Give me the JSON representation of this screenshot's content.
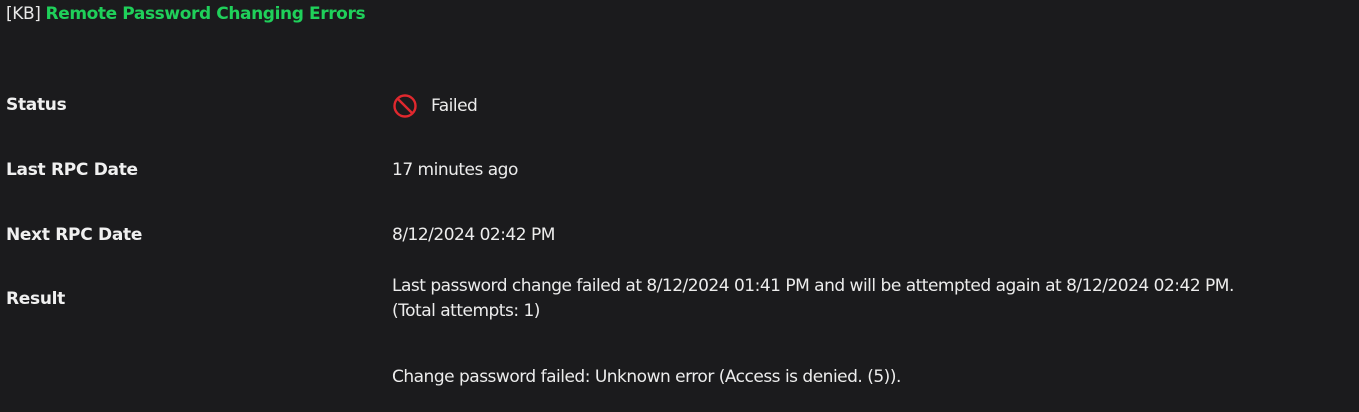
{
  "header": {
    "prefix": "[KB]",
    "link_text": "Remote Password Changing Errors"
  },
  "rows": {
    "status": {
      "label": "Status",
      "value": "Failed",
      "icon": "prohibited-icon",
      "icon_color": "#e0282e"
    },
    "last_rpc": {
      "label": "Last RPC Date",
      "value": "17 minutes ago"
    },
    "next_rpc": {
      "label": "Next RPC Date",
      "value": "8/12/2024 02:42 PM"
    },
    "result": {
      "label": "Result",
      "line1": "Last password change failed at 8/12/2024 01:41 PM and will be attempted again at 8/12/2024 02:42 PM.",
      "line2": "(Total attempts: 1)",
      "error": "Change password failed: Unknown error (Access is denied. (5))."
    }
  },
  "colors": {
    "background": "#1b1b1d",
    "link": "#1fd05a",
    "text": "#ececec"
  }
}
